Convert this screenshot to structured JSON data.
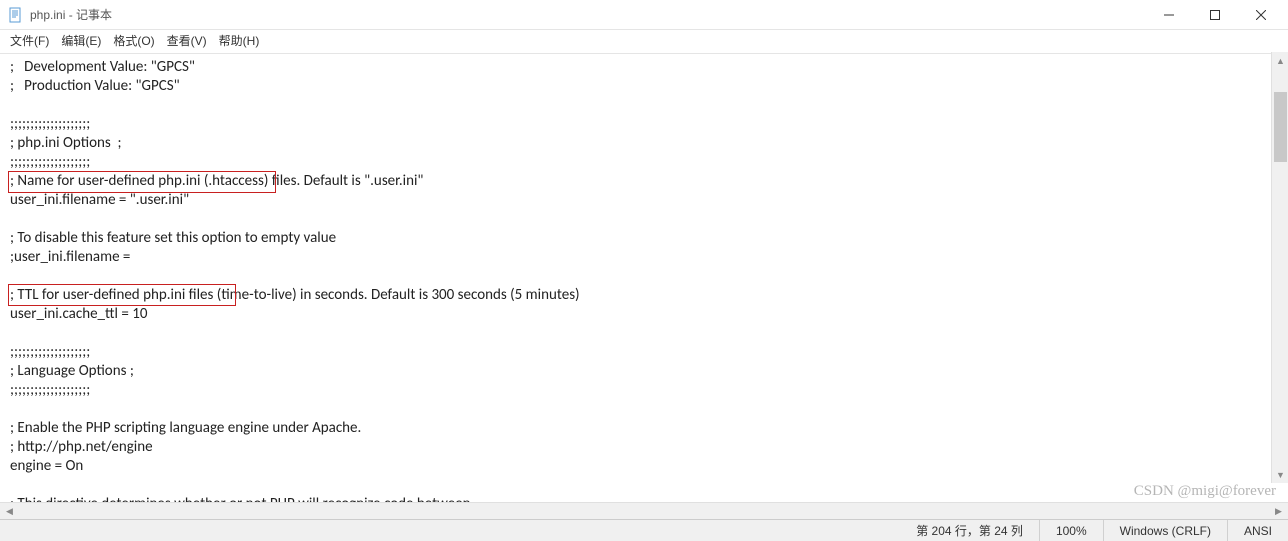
{
  "window": {
    "title": "php.ini - 记事本"
  },
  "menu": {
    "file": "文件(F)",
    "edit": "编辑(E)",
    "format": "格式(O)",
    "view": "查看(V)",
    "help": "帮助(H)"
  },
  "content": {
    "lines": [
      ";   Development Value: \"GPCS\"",
      ";   Production Value: \"GPCS\"",
      "",
      ";;;;;;;;;;;;;;;;;;;;",
      "; php.ini Options  ;",
      ";;;;;;;;;;;;;;;;;;;;",
      "; Name for user-defined php.ini (.htaccess) files. Default is \".user.ini\"",
      "user_ini.filename = \".user.ini\"",
      "",
      "; To disable this feature set this option to empty value",
      ";user_ini.filename =",
      "",
      "; TTL for user-defined php.ini files (time-to-live) in seconds. Default is 300 seconds (5 minutes)",
      "user_ini.cache_ttl = 10",
      "",
      ";;;;;;;;;;;;;;;;;;;;",
      "; Language Options ;",
      ";;;;;;;;;;;;;;;;;;;;",
      "",
      "; Enable the PHP scripting language engine under Apache.",
      "; http://php.net/engine",
      "engine = On",
      "",
      "; This directive determines whether or not PHP will recognize code between"
    ]
  },
  "statusbar": {
    "position": "第 204 行，第 24 列",
    "zoom": "100%",
    "eol": "Windows (CRLF)",
    "encoding": "ANSI"
  },
  "watermark": "CSDN @migi@forever"
}
